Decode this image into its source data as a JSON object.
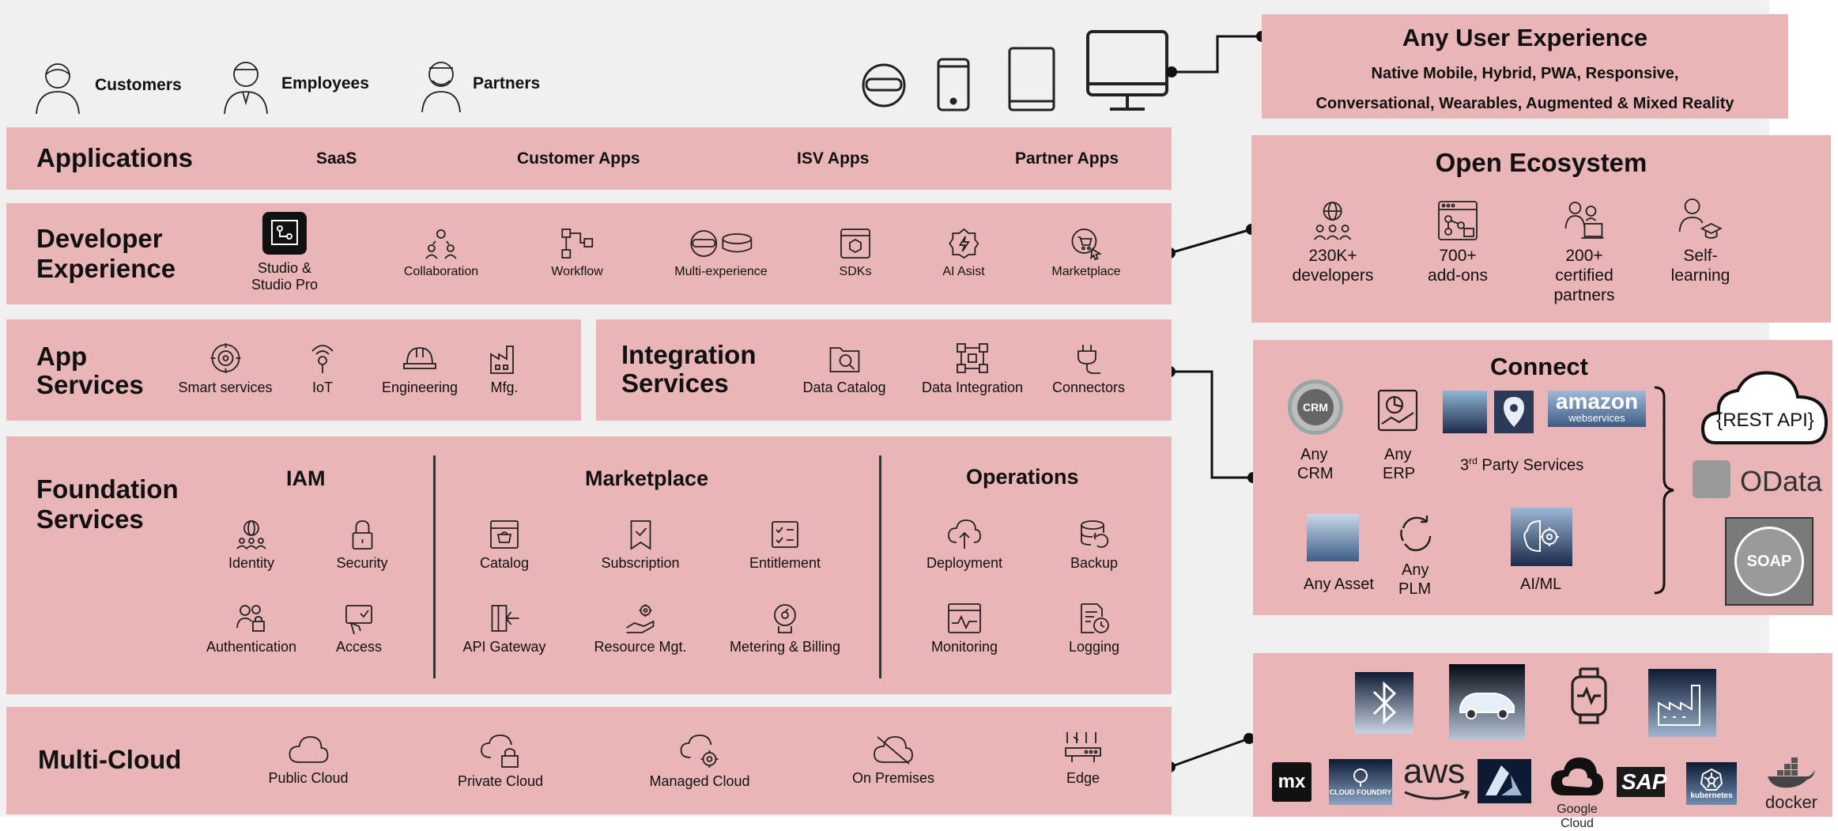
{
  "users": [
    {
      "label": "Customers",
      "icon": "customer-icon"
    },
    {
      "label": "Employees",
      "icon": "employee-icon"
    },
    {
      "label": "Partners",
      "icon": "partner-icon"
    }
  ],
  "devices": [
    "vr-headset-icon",
    "phone-icon",
    "tablet-icon",
    "desktop-icon"
  ],
  "any_ux": {
    "title": "Any User Experience",
    "line1": "Native Mobile, Hybrid, PWA, Responsive,",
    "line2": "Conversational, Wearables, Augmented & Mixed Reality"
  },
  "applications": {
    "title": "Applications",
    "items": [
      "SaaS",
      "Customer Apps",
      "ISV Apps",
      "Partner Apps"
    ]
  },
  "devx": {
    "title_line1": "Developer",
    "title_line2": "Experience",
    "items": [
      {
        "label": "Studio &\nStudio Pro",
        "l1": "Studio &",
        "l2": "Studio Pro",
        "icon": "studio-icon"
      },
      {
        "l1": "Collaboration",
        "icon": "collaboration-icon"
      },
      {
        "l1": "Workflow",
        "icon": "workflow-icon"
      },
      {
        "l1": "Multi-experience",
        "icon": "multi-experience-icon"
      },
      {
        "l1": "SDKs",
        "icon": "sdk-icon"
      },
      {
        "l1": "AI Asist",
        "icon": "ai-icon"
      },
      {
        "l1": "Marketplace",
        "icon": "marketplace-icon"
      }
    ]
  },
  "ecosystem": {
    "title": "Open Ecosystem",
    "items": [
      {
        "l1": "230K+",
        "l2": "developers",
        "l3": "",
        "icon": "developers-globe-icon"
      },
      {
        "l1": "700+",
        "l2": "add-ons",
        "l3": "",
        "icon": "addons-icon"
      },
      {
        "l1": "200+",
        "l2": "certified",
        "l3": "partners",
        "icon": "certified-partners-icon"
      },
      {
        "l1": "Self-",
        "l2": "learning",
        "l3": "",
        "icon": "self-learning-icon"
      }
    ]
  },
  "app_services": {
    "title_line1": "App",
    "title_line2": "Services",
    "items": [
      {
        "l1": "Smart services",
        "icon": "smart-services-icon"
      },
      {
        "l1": "IoT",
        "icon": "iot-icon"
      },
      {
        "l1": "Engineering",
        "icon": "engineering-icon"
      },
      {
        "l1": "Mfg.",
        "icon": "manufacturing-icon"
      }
    ]
  },
  "integration_services": {
    "title_line1": "Integration",
    "title_line2": "Services",
    "items": [
      {
        "l1": "Data Catalog",
        "icon": "data-catalog-icon"
      },
      {
        "l1": "Data Integration",
        "icon": "data-integration-icon"
      },
      {
        "l1": "Connectors",
        "icon": "connectors-icon"
      }
    ]
  },
  "connect": {
    "title": "Connect",
    "any_crm_1": "Any",
    "any_crm_2": "CRM",
    "crm_badge": "CRM",
    "any_erp_1": "Any",
    "any_erp_2": "ERP",
    "third_party": "3",
    "third_party_sup": "rd",
    "third_party_rest": " Party Services",
    "any_asset": "Any Asset",
    "any_plm_1": "Any",
    "any_plm_2": "PLM",
    "aiml": "AI/ML",
    "rest_api": "{REST API}",
    "odata": "OData",
    "soap": "SOAP",
    "amazon_1": "amazon",
    "amazon_2": "webservices"
  },
  "foundation": {
    "title_line1": "Foundation",
    "title_line2": "Services",
    "iam": {
      "title": "IAM",
      "items": [
        {
          "l1": "Identity",
          "icon": "identity-icon"
        },
        {
          "l1": "Security",
          "icon": "security-lock-icon"
        },
        {
          "l1": "Authentication",
          "icon": "authentication-icon"
        },
        {
          "l1": "Access",
          "icon": "access-icon"
        }
      ]
    },
    "marketplace": {
      "title": "Marketplace",
      "items": [
        {
          "l1": "Catalog",
          "icon": "catalog-icon"
        },
        {
          "l1": "Subscription",
          "icon": "subscription-icon"
        },
        {
          "l1": "Entitlement",
          "icon": "entitlement-icon"
        },
        {
          "l1": "API Gateway",
          "icon": "api-gateway-icon"
        },
        {
          "l1": "Resource Mgt.",
          "icon": "resource-mgt-icon"
        },
        {
          "l1": "Metering & Billing",
          "icon": "metering-billing-icon"
        }
      ]
    },
    "operations": {
      "title": "Operations",
      "items": [
        {
          "l1": "Deployment",
          "icon": "deployment-icon"
        },
        {
          "l1": "Backup",
          "icon": "backup-icon"
        },
        {
          "l1": "Monitoring",
          "icon": "monitoring-icon"
        },
        {
          "l1": "Logging",
          "icon": "logging-icon"
        }
      ]
    }
  },
  "multicloud": {
    "title": "Multi-Cloud",
    "items": [
      {
        "l1": "Public Cloud",
        "icon": "public-cloud-icon"
      },
      {
        "l1": "Private Cloud",
        "icon": "private-cloud-icon"
      },
      {
        "l1": "Managed Cloud",
        "icon": "managed-cloud-icon"
      },
      {
        "l1": "On Premises",
        "icon": "on-premises-icon"
      },
      {
        "l1": "Edge",
        "icon": "edge-icon"
      }
    ]
  },
  "cloud_logos": {
    "mx": "mx",
    "cloudfoundry": "CLOUD FOUNDRY",
    "aws": "aws",
    "google": "Google Cloud",
    "sap": "SAP",
    "kubernetes": "kubernetes",
    "docker": "docker"
  },
  "colors": {
    "panel": "#e9b5b7",
    "background": "#f0f0f0",
    "line": "#111111"
  }
}
